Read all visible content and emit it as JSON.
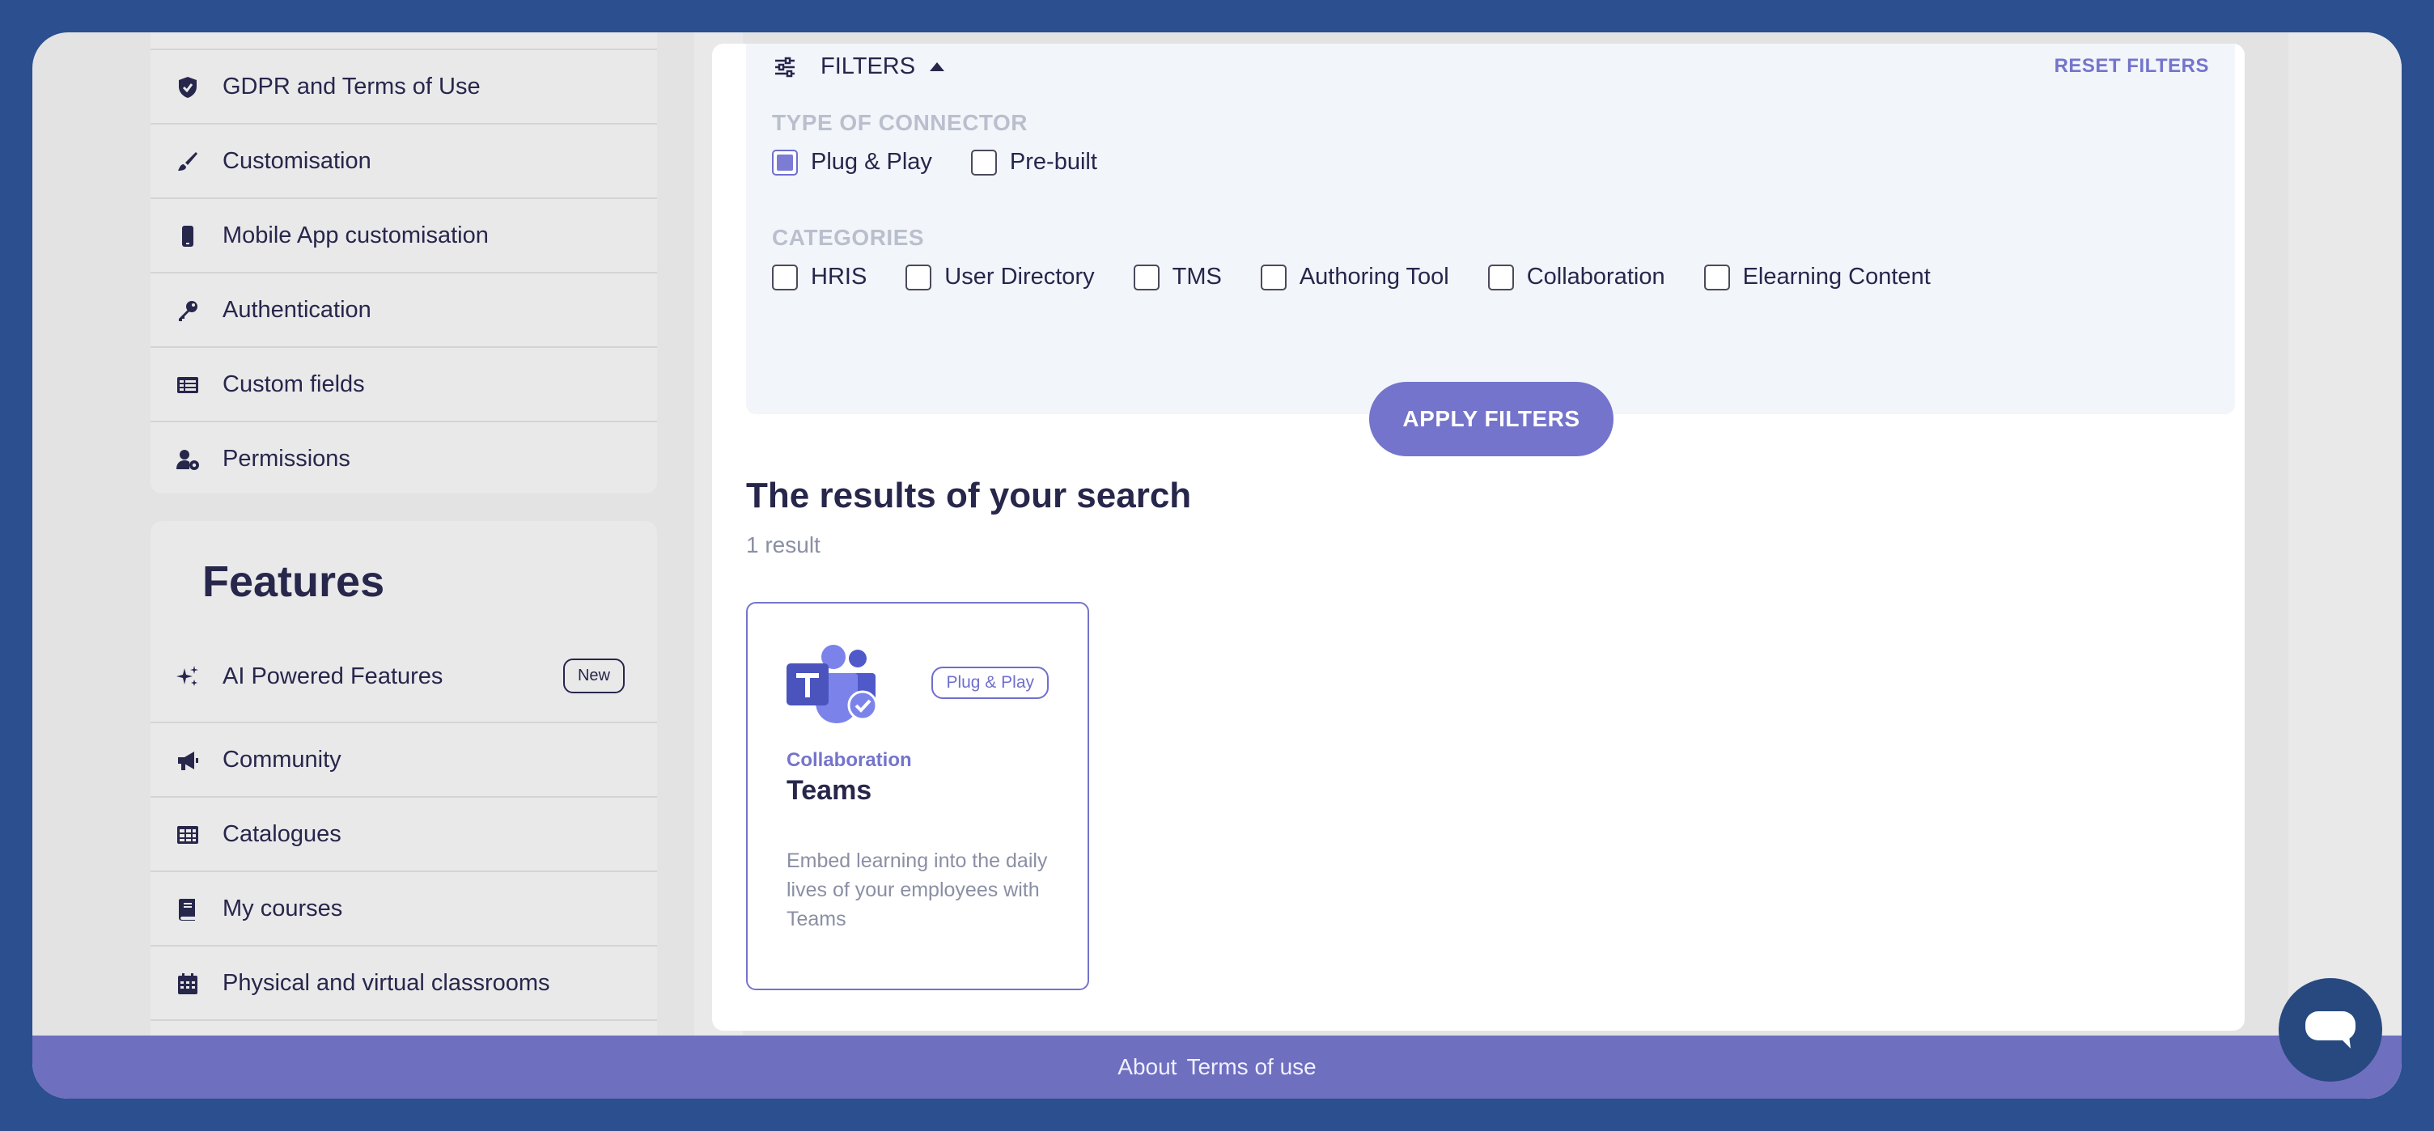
{
  "sidebar_top": {
    "items": [
      {
        "label": "GDPR and Terms of Use",
        "icon": "shield-check-icon"
      },
      {
        "label": "Customisation",
        "icon": "paintbrush-icon"
      },
      {
        "label": "Mobile App customisation",
        "icon": "mobile-icon"
      },
      {
        "label": "Authentication",
        "icon": "key-icon"
      },
      {
        "label": "Custom fields",
        "icon": "table-list-icon"
      },
      {
        "label": "Permissions",
        "icon": "user-gear-icon"
      }
    ]
  },
  "sidebar_features": {
    "title": "Features",
    "items": [
      {
        "label": "AI Powered Features",
        "icon": "sparkles-icon",
        "badge": "New"
      },
      {
        "label": "Community",
        "icon": "megaphone-icon"
      },
      {
        "label": "Catalogues",
        "icon": "grid-icon"
      },
      {
        "label": "My courses",
        "icon": "book-icon"
      },
      {
        "label": "Physical and virtual classrooms",
        "icon": "calendar-icon"
      }
    ]
  },
  "filters": {
    "header_label": "FILTERS",
    "reset_label": "RESET FILTERS",
    "connector_section_label": "TYPE OF CONNECTOR",
    "connector_options": [
      {
        "label": "Plug & Play",
        "checked": true
      },
      {
        "label": "Pre-built",
        "checked": false
      }
    ],
    "categories_section_label": "CATEGORIES",
    "category_options": [
      {
        "label": "HRIS",
        "checked": false
      },
      {
        "label": "User Directory",
        "checked": false
      },
      {
        "label": "TMS",
        "checked": false
      },
      {
        "label": "Authoring Tool",
        "checked": false
      },
      {
        "label": "Collaboration",
        "checked": false
      },
      {
        "label": "Elearning Content",
        "checked": false
      }
    ],
    "apply_label": "APPLY FILTERS"
  },
  "results": {
    "title": "The results of your search",
    "count_label": "1 result",
    "cards": [
      {
        "tag": "Plug & Play",
        "category": "Collaboration",
        "name": "Teams",
        "description": "Embed learning into the daily lives of your employees with Teams",
        "logo": "microsoft-teams-logo"
      }
    ]
  },
  "footer": {
    "links": [
      "About",
      "Terms of use"
    ]
  },
  "colors": {
    "accent": "#7474cc",
    "text_dark": "#27264b",
    "footer": "#6f6fc0",
    "background": "#2b4f8f"
  }
}
